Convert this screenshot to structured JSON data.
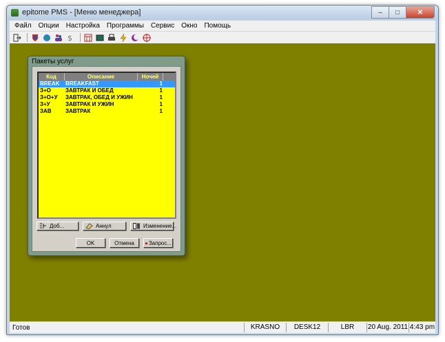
{
  "window": {
    "title": "epitome PMS - [Меню менеджера]",
    "minimize_label": "–",
    "maximize_label": "□",
    "close_label": "✕"
  },
  "menu": [
    "Файл",
    "Опции",
    "Настройка",
    "Программы",
    "Сервис",
    "Окно",
    "Помощь"
  ],
  "toolbar_icons": [
    "exit-icon",
    "shield-icon",
    "globe-icon",
    "people-icon",
    "currency-icon",
    "calendar-icon",
    "screen-icon",
    "printer-icon",
    "lightning-icon",
    "moon-icon",
    "target-icon"
  ],
  "colors": {
    "workspace": "#808000",
    "grid_bg": "#ffff00",
    "grid_header_text": "#ffff80",
    "selection": "#3399ff"
  },
  "dialog": {
    "title": "Пакеты услуг",
    "columns": [
      "Код",
      "Описание",
      "Ночей"
    ],
    "rows": [
      {
        "code": "BREAK",
        "desc": "BREAKFAST",
        "nights": "1",
        "selected": true
      },
      {
        "code": "З+О",
        "desc": "ЗАВТРАК И ОБЕД",
        "nights": "1",
        "selected": false
      },
      {
        "code": "З+О+У",
        "desc": "ЗАВТРАК, ОБЕД И УЖИН",
        "nights": "1",
        "selected": false
      },
      {
        "code": "З+У",
        "desc": "ЗАВТРАК И УЖИН",
        "nights": "1",
        "selected": false
      },
      {
        "code": "ЗАВ",
        "desc": "ЗАВТРАК",
        "nights": "1",
        "selected": false
      }
    ],
    "add_label": "Доб...",
    "cancel_item_label": "Аннул",
    "edit_label": "Изменение...",
    "ok_label": "OK",
    "cancel_label": "Отмена",
    "query_label": "Запрос..."
  },
  "status": {
    "text": "Готов",
    "user": "KRASNO",
    "desk": "DESK12",
    "lang": "LBR",
    "date": "20 Aug. 2011",
    "time": "4:43 pm"
  }
}
